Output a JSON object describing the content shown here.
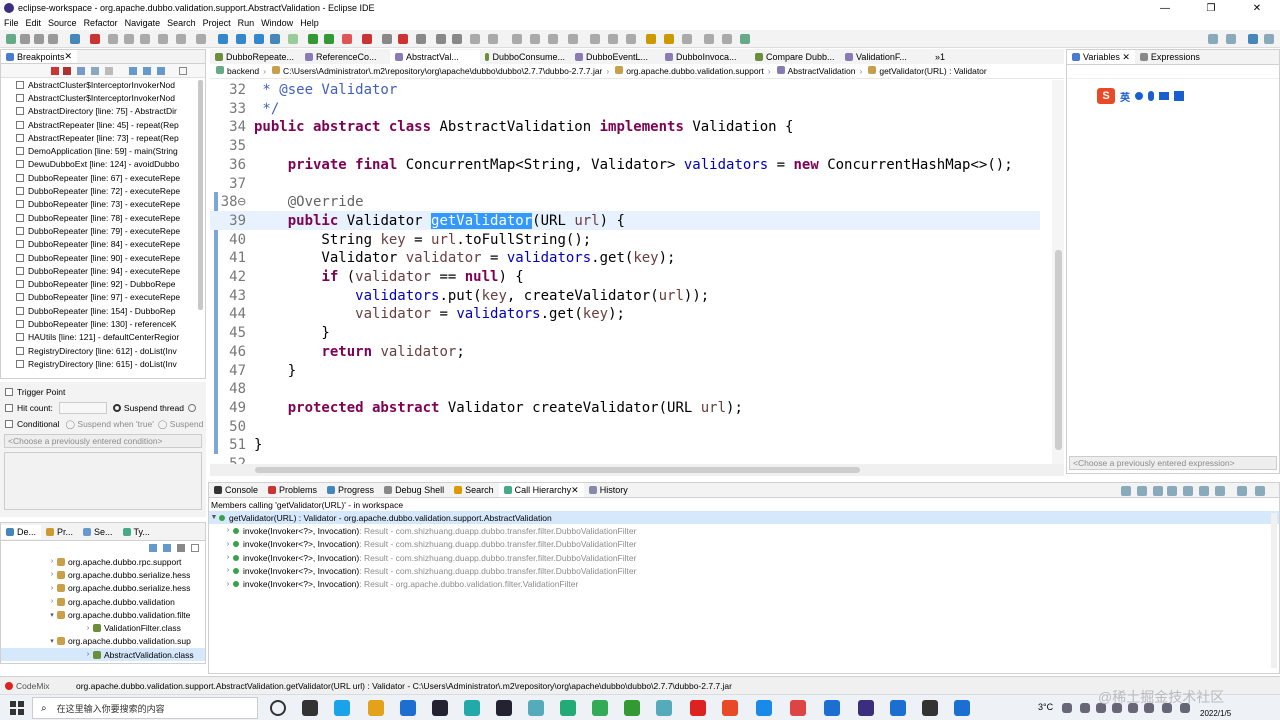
{
  "window": {
    "title": "eclipse-workspace - org.apache.dubbo.validation.support.AbstractValidation - Eclipse IDE",
    "min": "—",
    "max": "❐",
    "close": "✕"
  },
  "menu": [
    "File",
    "Edit",
    "Source",
    "Refactor",
    "Navigate",
    "Search",
    "Project",
    "Run",
    "Window",
    "Help"
  ],
  "left_tabs": {
    "breakpoints": "Breakpoints"
  },
  "breakpoints": [
    "AbstractCluster$InterceptorInvokerNod",
    "AbstractCluster$InterceptorInvokerNod",
    "AbstractDirectory [line: 75] - AbstractDir",
    "AbstractRepeater [line: 45] - repeat(Rep",
    "AbstractRepeater [line: 73] - repeat(Rep",
    "DemoApplication [line: 59] - main(String",
    "DewuDubboExt [line: 124] - avoidDubbo",
    "DubboRepeater [line: 67] - executeRepe",
    "DubboRepeater [line: 72] - executeRepe",
    "DubboRepeater [line: 73] - executeRepe",
    "DubboRepeater [line: 78] - executeRepe",
    "DubboRepeater [line: 79] - executeRepe",
    "DubboRepeater [line: 84] - executeRepe",
    "DubboRepeater [line: 90] - executeRepe",
    "DubboRepeater [line: 94] - executeRepe",
    "DubboRepeater [line: 92] - DubboRepe",
    "DubboRepeater [line: 97] - executeRepe",
    "DubboRepeater [line: 154] - DubboRep",
    "DubboRepeater [line: 130] - referenceK",
    "HAUtils [line: 121] - defaultCenterRegior",
    "RegistryDirectory [line: 612] - doList(Inv",
    "RegistryDirectory [line: 615] - doList(Inv"
  ],
  "bp_options": {
    "trigger_point": "Trigger Point",
    "hit_count": "Hit count:",
    "suspend_thread": "Suspend thread",
    "conditional": "Conditional",
    "suspend_true": "Suspend when 'true'",
    "suspend_short": "Suspend",
    "condition_placeholder": "<Choose a previously entered condition>"
  },
  "lower_left_tabs": [
    "De...",
    "Pr...",
    "Se...",
    "Ty..."
  ],
  "package_tree": [
    {
      "label": "org.apache.dubbo.rpc.support",
      "indent": 1,
      "kind": "pkg",
      "open": false
    },
    {
      "label": "org.apache.dubbo.serialize.hess",
      "indent": 1,
      "kind": "pkg",
      "open": false
    },
    {
      "label": "org.apache.dubbo.serialize.hess",
      "indent": 1,
      "kind": "pkg",
      "open": false
    },
    {
      "label": "org.apache.dubbo.validation",
      "indent": 1,
      "kind": "pkg",
      "open": false
    },
    {
      "label": "org.apache.dubbo.validation.filte",
      "indent": 1,
      "kind": "pkg",
      "open": true
    },
    {
      "label": "ValidationFilter.class",
      "indent": 2,
      "kind": "class",
      "open": false
    },
    {
      "label": "org.apache.dubbo.validation.sup",
      "indent": 1,
      "kind": "pkg",
      "open": true
    },
    {
      "label": "AbstractValidation.class",
      "indent": 2,
      "kind": "class",
      "open": false,
      "selected": true
    }
  ],
  "editor_tabs": [
    "DubboRepeate...",
    "ReferenceCo...",
    "AbstractVal...",
    "DubboConsume...",
    "DubboEventL...",
    "DubboInvoca...",
    "Compare Dubb...",
    "ValidationF...",
    "»1"
  ],
  "breadcrumb": [
    "backend",
    "C:\\Users\\Administrator\\.m2\\repository\\org\\apache\\dubbo\\dubbo\\2.7.7\\dubbo-2.7.7.jar",
    "org.apache.dubbo.validation.support",
    "AbstractValidation",
    "getValidator(URL) : Validator"
  ],
  "code_lines": [
    {
      "n": "32",
      "html": "<span class=\"cmt\"> * @see Validator</span>"
    },
    {
      "n": "33",
      "html": "<span class=\"cmt\"> */</span>"
    },
    {
      "n": "34",
      "html": "<span class=\"kw\">public abstract class</span> AbstractValidation <span class=\"kw\">implements</span> Validation {"
    },
    {
      "n": "35",
      "html": ""
    },
    {
      "n": "36",
      "html": "    <span class=\"kw\">private final</span> ConcurrentMap&lt;String, Validator&gt; <span class=\"fld\">validators</span> = <span class=\"kw\">new</span> ConcurrentHashMap&lt;&gt;();"
    },
    {
      "n": "37",
      "html": ""
    },
    {
      "n": "38⊖",
      "html": "    <span class=\"ann\">@Override</span>"
    },
    {
      "n": "39",
      "html": "    <span class=\"kw\">public</span> Validator <span class=\"sel\">getValidator</span>(URL <span class=\"var\">url</span>) {"
    },
    {
      "n": "40",
      "html": "        String <span class=\"var\">key</span> = <span class=\"var\">url</span>.toFullString();"
    },
    {
      "n": "41",
      "html": "        Validator <span class=\"var\">validator</span> = <span class=\"fld\">validators</span>.get(<span class=\"var\">key</span>);"
    },
    {
      "n": "42",
      "html": "        <span class=\"kw\">if</span> (<span class=\"var\">validator</span> == <span class=\"kw\">null</span>) {"
    },
    {
      "n": "43",
      "html": "            <span class=\"fld\">validators</span>.put(<span class=\"var\">key</span>, createValidator(<span class=\"var\">url</span>));"
    },
    {
      "n": "44",
      "html": "            <span class=\"var\">validator</span> = <span class=\"fld\">validators</span>.get(<span class=\"var\">key</span>);"
    },
    {
      "n": "45",
      "html": "        }"
    },
    {
      "n": "46",
      "html": "        <span class=\"kw\">return</span> <span class=\"var\">validator</span>;"
    },
    {
      "n": "47",
      "html": "    }"
    },
    {
      "n": "48",
      "html": ""
    },
    {
      "n": "49",
      "html": "    <span class=\"kw\">protected abstract</span> Validator createValidator(URL <span class=\"var\">url</span>);"
    },
    {
      "n": "50",
      "html": ""
    },
    {
      "n": "51",
      "html": "}"
    },
    {
      "n": "52",
      "html": ""
    }
  ],
  "right_tabs": {
    "variables": "Variables",
    "expressions": "Expressions",
    "expr_placeholder": "<Choose a previously entered expression>"
  },
  "ime": {
    "lang": "英"
  },
  "bottom_tabs": [
    "Console",
    "Problems",
    "Progress",
    "Debug Shell",
    "Search",
    "Call Hierarchy",
    "History"
  ],
  "call_hierarchy": {
    "header": "Members calling 'getValidator(URL)' - in workspace",
    "root": "getValidator(URL) : Validator - org.apache.dubbo.validation.support.AbstractValidation",
    "items": [
      {
        "method": "invoke(Invoker<?>, Invocation)",
        "result": " : Result - com.shizhuang.duapp.dubbo.transfer.filter.DubboValidationFilter"
      },
      {
        "method": "invoke(Invoker<?>, Invocation)",
        "result": " : Result - com.shizhuang.duapp.dubbo.transfer.filter.DubboValidationFilter"
      },
      {
        "method": "invoke(Invoker<?>, Invocation)",
        "result": " : Result - com.shizhuang.duapp.dubbo.transfer.filter.DubboValidationFilter"
      },
      {
        "method": "invoke(Invoker<?>, Invocation)",
        "result": " : Result - com.shizhuang.duapp.dubbo.transfer.filter.DubboValidationFilter"
      },
      {
        "method": "invoke(Invoker<?>, Invocation)",
        "result": " : Result - org.apache.dubbo.validation.filter.ValidationFilter"
      }
    ]
  },
  "statusbar": {
    "codemix": "CodeMix",
    "text": "org.apache.dubbo.validation.support.AbstractValidation.getValidator(URL url) : Validator - C:\\Users\\Administrator\\.m2\\repository\\org\\apache\\dubbo\\dubbo\\2.7.7\\dubbo-2.7.7.jar"
  },
  "taskbar": {
    "search_placeholder": "在这里输入你要搜索的内容",
    "weather": "3°C",
    "date": "2022/1/5",
    "watermark": "@稀土掘金技术社区"
  }
}
